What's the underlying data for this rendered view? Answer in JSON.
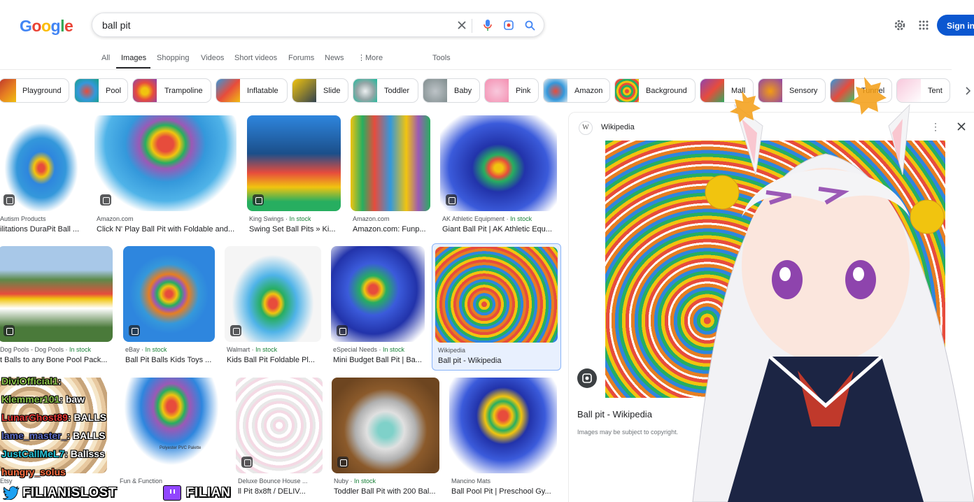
{
  "header": {
    "logo": [
      "G",
      "o",
      "o",
      "g",
      "l",
      "e"
    ],
    "query": "ball pit",
    "signin": "Sign in"
  },
  "tabs": [
    "All",
    "Images",
    "Shopping",
    "Videos",
    "Short videos",
    "Forums",
    "News",
    "More",
    "Tools"
  ],
  "chips": [
    "Playground",
    "Pool",
    "Trampoline",
    "Inflatable",
    "Slide",
    "Toddler",
    "Baby",
    "Pink",
    "Amazon",
    "Background",
    "Mall",
    "Sensory",
    "Tunnel",
    "Tent"
  ],
  "results": [
    {
      "src": "Autism Products",
      "stock": "",
      "title": "ilitations DuraPit Ball ..."
    },
    {
      "src": "Amazon.com",
      "stock": "",
      "title": "Click N' Play Ball Pit with Foldable and..."
    },
    {
      "src": "King Swings",
      "stock": "In stock",
      "title": "Swing Set Ball Pits » Ki..."
    },
    {
      "src": "Amazon.com",
      "stock": "",
      "title": "Amazon.com: Funp..."
    },
    {
      "src": "AK Athletic Equipment",
      "stock": "In stock",
      "title": "Giant Ball Pit | AK Athletic Equ..."
    },
    {
      "src": "Dog Pools - Dog Pools",
      "stock": "In stock",
      "title": "t Balls to any Bone Pool Pack..."
    },
    {
      "src": "eBay",
      "stock": "In stock",
      "title": "Ball Pit Balls Kids Toys ..."
    },
    {
      "src": "Walmart",
      "stock": "In stock",
      "title": "Kids Ball Pit Foldable Pl..."
    },
    {
      "src": "eSpecial Needs",
      "stock": "In stock",
      "title": "Mini Budget Ball Pit | Ba..."
    },
    {
      "src": "Wikipedia",
      "stock": "",
      "title": "Ball pit - Wikipedia"
    },
    {
      "src": "Etsy",
      "stock": "",
      "title": ""
    },
    {
      "src": "Fun & Function",
      "stock": "",
      "title": ""
    },
    {
      "src": "Deluxe Bounce House ...",
      "stock": "",
      "title": "ll Pit 8x8ft / DELIV..."
    },
    {
      "src": "Nuby",
      "stock": "In stock",
      "title": "Toddler Ball Pit with 200 Bal..."
    },
    {
      "src": "Mancino Mats",
      "stock": "",
      "title": "Ball Pool Pit | Preschool Gy..."
    }
  ],
  "image_caption": "Polyester PVC Palette",
  "panel": {
    "site": "Wikipedia",
    "title": "Ball pit - Wikipedia",
    "note": "Images may be subject to copyright."
  },
  "overlay": {
    "chat": [
      {
        "name": "DiviOfficial1",
        "msg": ":"
      },
      {
        "name": "Klemmer101",
        "msg": ": baw"
      },
      {
        "name": "LunarGhost89",
        "msg": ": BALLS"
      },
      {
        "name": "lame_master_",
        "msg": ": BALLS"
      },
      {
        "name": "JustCallMeL7",
        "msg": ": Ballsss"
      },
      {
        "name": "hungry_solus",
        "msg": ""
      }
    ],
    "twitter": "FILIANISLOST",
    "twitch": "FILIAN"
  },
  "colors": {
    "accent": "#0b57d0",
    "stock": "#188038"
  }
}
